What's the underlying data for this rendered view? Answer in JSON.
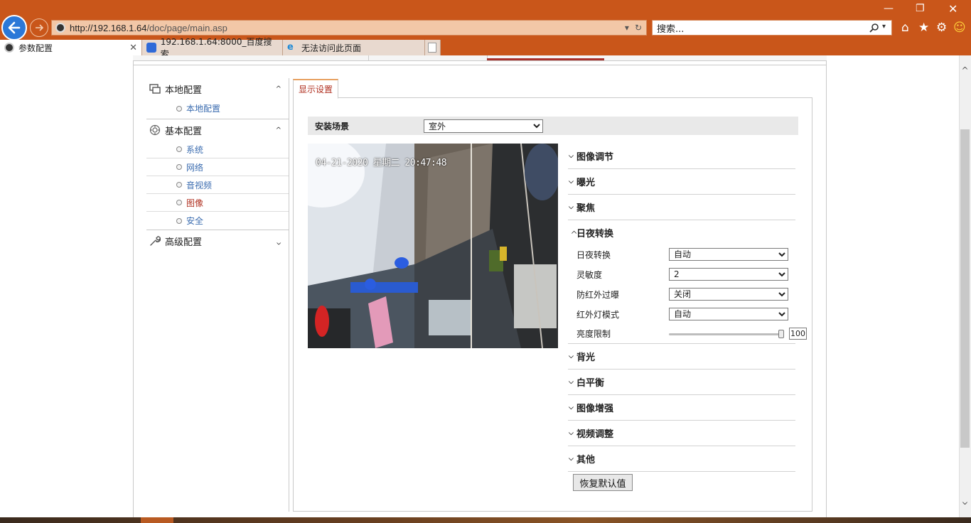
{
  "browser": {
    "url_host": "http://192.168.1.64",
    "url_path": "/doc/page/main.asp",
    "search_placeholder": "搜索...",
    "tabs": [
      {
        "label": "参数配置",
        "active": true
      },
      {
        "label": "192.168.1.64:8000_百度搜索",
        "active": false
      },
      {
        "label": "无法访问此页面",
        "active": false
      }
    ]
  },
  "sidebar": {
    "groups": [
      {
        "label": "本地配置",
        "icon": "local-config-icon",
        "expanded": true,
        "items": [
          "本地配置"
        ]
      },
      {
        "label": "基本配置",
        "icon": "basic-config-icon",
        "expanded": true,
        "items": [
          "系统",
          "网络",
          "音视频",
          "图像",
          "安全"
        ]
      },
      {
        "label": "高级配置",
        "icon": "wrench-icon",
        "expanded": false,
        "items": []
      }
    ],
    "active_item": "图像"
  },
  "content": {
    "tab_label": "显示设置",
    "scene_label": "安装场景",
    "scene_value": "室外",
    "osd_text": "04-21-2020 星期二 20:47:48",
    "sections": {
      "image_adjust": "图像调节",
      "exposure": "曝光",
      "focus": "聚焦",
      "day_night": "日夜转换",
      "backlight": "背光",
      "white_balance": "白平衡",
      "image_enhance": "图像增强",
      "video_adjust": "视频调整",
      "other": "其他"
    },
    "day_night": {
      "mode_label": "日夜转换",
      "mode_value": "自动",
      "sensitivity_label": "灵敏度",
      "sensitivity_value": "2",
      "anti_ir_label": "防红外过曝",
      "anti_ir_value": "关闭",
      "ir_mode_label": "红外灯模式",
      "ir_mode_value": "自动",
      "brightness_label": "亮度限制",
      "brightness_value": "100",
      "brightness_fraction": 1.0
    },
    "restore_label": "恢复默认值"
  },
  "colors": {
    "chrome_accent": "#c9561a",
    "active_link": "#b03020",
    "link": "#3c6db0"
  }
}
